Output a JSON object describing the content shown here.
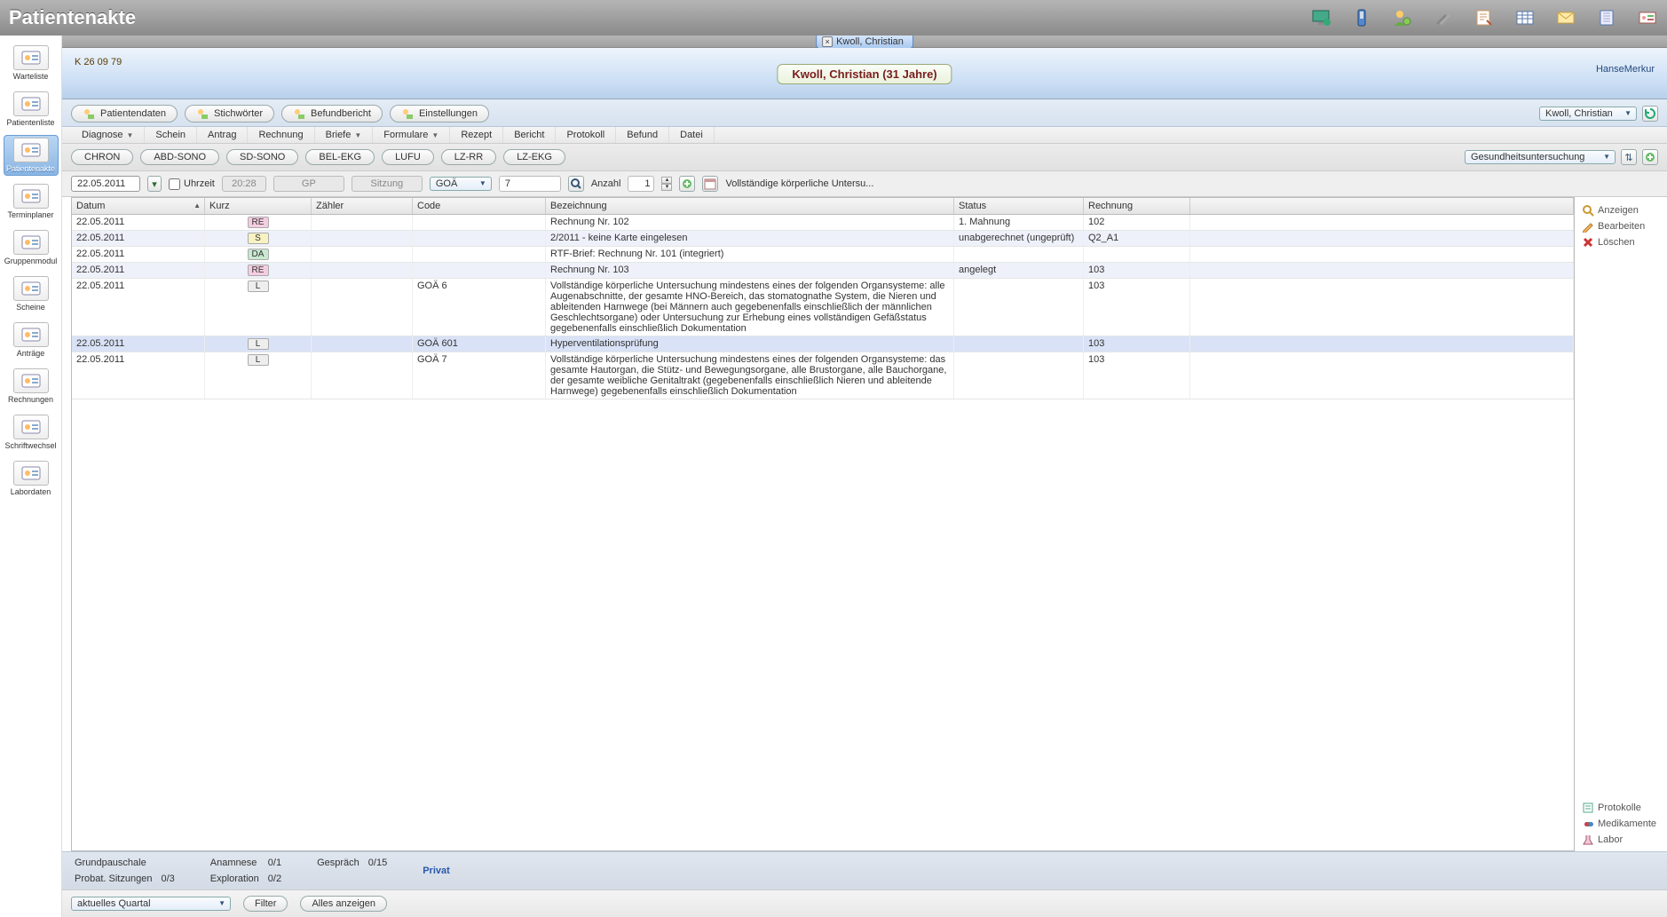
{
  "app_title": "Patientenakte",
  "top_icons": [
    "monitor-plus",
    "phone",
    "user-gear",
    "wrench-cross",
    "form-edit",
    "grid",
    "mail",
    "notebook",
    "card-user"
  ],
  "sidebar": [
    {
      "label": "Warteliste",
      "id": "warteliste"
    },
    {
      "label": "Patientenliste",
      "id": "patientenliste"
    },
    {
      "label": "Patientenakte",
      "id": "patientenakte",
      "active": true
    },
    {
      "label": "Terminplaner",
      "id": "terminplaner"
    },
    {
      "label": "Gruppenmodul",
      "id": "gruppenmodul"
    },
    {
      "label": "Scheine",
      "id": "scheine"
    },
    {
      "label": "Anträge",
      "id": "antraege"
    },
    {
      "label": "Rechnungen",
      "id": "rechnungen"
    },
    {
      "label": "Schriftwechsel",
      "id": "schriftwechsel"
    },
    {
      "label": "Labordaten",
      "id": "labordaten"
    }
  ],
  "tab": {
    "close": "×",
    "label": "Kwoll, Christian"
  },
  "patient": {
    "id": "K 26 09 79",
    "name_badge": "Kwoll, Christian (31 Jahre)",
    "insurance": "HanseMerkur"
  },
  "toolbar1": {
    "btns": [
      {
        "id": "patientendaten",
        "label": "Patientendaten"
      },
      {
        "id": "stichwoerter",
        "label": "Stichwörter"
      },
      {
        "id": "befundbericht",
        "label": "Befundbericht"
      },
      {
        "id": "einstellungen",
        "label": "Einstellungen"
      }
    ],
    "patient_select": "Kwoll, Christian"
  },
  "menu": [
    {
      "label": "Diagnose",
      "dd": true
    },
    {
      "label": "Schein"
    },
    {
      "label": "Antrag"
    },
    {
      "label": "Rechnung"
    },
    {
      "label": "Briefe",
      "dd": true
    },
    {
      "label": "Formulare",
      "dd": true
    },
    {
      "label": "Rezept"
    },
    {
      "label": "Bericht"
    },
    {
      "label": "Protokoll"
    },
    {
      "label": "Befund"
    },
    {
      "label": "Datei"
    }
  ],
  "tags": [
    "CHRON",
    "ABD-SONO",
    "SD-SONO",
    "BEL-EKG",
    "LUFU",
    "LZ-RR",
    "LZ-EKG"
  ],
  "tags_right_select": "Gesundheitsuntersuchung",
  "filter": {
    "date": "22.05.2011",
    "uhrzeit_label": "Uhrzeit",
    "uhrzeit_value": "20:28",
    "gp": "GP",
    "sitzung": "Sitzung",
    "tarif": "GOÄ",
    "code": "7",
    "anzahl_label": "Anzahl",
    "anzahl_value": "1",
    "desc": "Vollständige körperliche Untersu..."
  },
  "table": {
    "headers": {
      "datum": "Datum",
      "kurz": "Kurz",
      "zaehler": "Zähler",
      "code": "Code",
      "bez": "Bezeichnung",
      "status": "Status",
      "rechnung": "Rechnung"
    },
    "rows": [
      {
        "datum": "22.05.2011",
        "kurz": "RE",
        "bez": "Rechnung Nr. 102",
        "status": "1. Mahnung",
        "rech": "102"
      },
      {
        "datum": "22.05.2011",
        "kurz": "S",
        "bez": "2/2011 - keine Karte eingelesen",
        "status": "unabgerechnet (ungeprüft)",
        "rech": "Q2_A1"
      },
      {
        "datum": "22.05.2011",
        "kurz": "DA",
        "bez": "RTF-Brief: Rechnung Nr. 101 (integriert)",
        "status": "",
        "rech": ""
      },
      {
        "datum": "22.05.2011",
        "kurz": "RE",
        "bez": "Rechnung Nr. 103",
        "status": "angelegt",
        "rech": "103"
      },
      {
        "datum": "22.05.2011",
        "kurz": "L",
        "code": "GOÄ 6",
        "bez": "Vollständige körperliche Untersuchung mindestens eines der folgenden Organsysteme: alle Augenabschnitte, der gesamte HNO-Bereich, das stomatognathe System, die Nieren und ableitenden Harnwege (bei Männern auch gegebenenfalls einschließlich der männlichen Geschlechtsorgane) oder Untersuchung zur Erhebung eines vollständigen Gefäßstatus gegebenenfalls einschließlich Dokumentation",
        "rech": "103"
      },
      {
        "datum": "22.05.2011",
        "kurz": "L",
        "code": "GOÄ 601",
        "bez": "Hyperventilationsprüfung",
        "rech": "103",
        "sel": true
      },
      {
        "datum": "22.05.2011",
        "kurz": "L",
        "code": "GOÄ 7",
        "bez": "Vollständige körperliche Untersuchung mindestens eines der folgenden Organsysteme: das gesamte Hautorgan, die Stütz- und Bewegungsorgane, alle Brustorgane, alle Bauchorgane, der gesamte weibliche Genitaltrakt (gegebenenfalls einschließlich Nieren und ableitende Harnwege) gegebenenfalls einschließlich Dokumentation",
        "rech": "103"
      }
    ]
  },
  "sidepanel": {
    "anzeigen": "Anzeigen",
    "bearbeiten": "Bearbeiten",
    "loeschen": "Löschen"
  },
  "minipanel": {
    "protokolle": "Protokolle",
    "medikamente": "Medikamente",
    "labor": "Labor"
  },
  "footer1": {
    "grundpauschale": "Grundpauschale",
    "probat": "Probat. Sitzungen",
    "probat_v": "0/3",
    "anamnese": "Anamnese",
    "anamnese_v": "0/1",
    "exploration": "Exploration",
    "exploration_v": "0/2",
    "gespraech": "Gespräch",
    "gespraech_v": "0/15",
    "privat": "Privat"
  },
  "footer2": {
    "quartal": "aktuelles Quartal",
    "filter": "Filter",
    "alles": "Alles anzeigen"
  }
}
